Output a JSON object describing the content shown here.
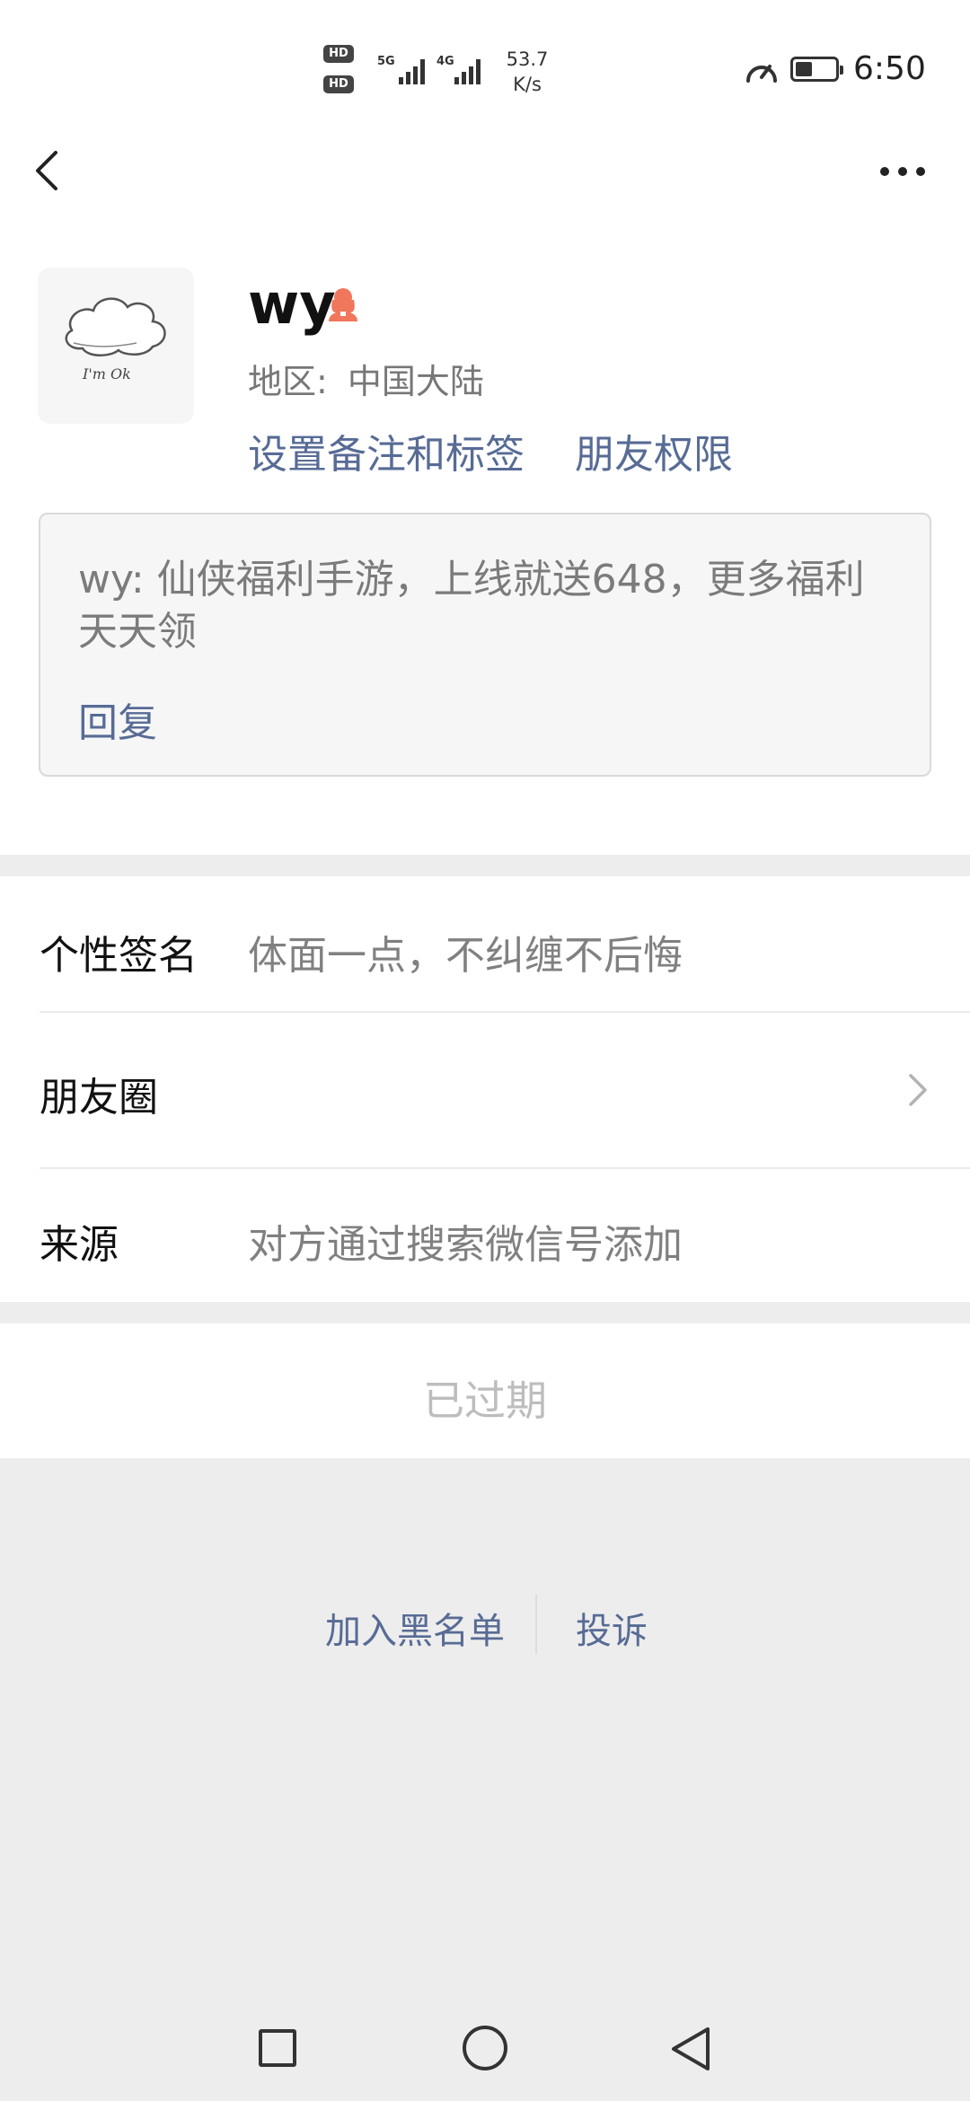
{
  "status_bar": {
    "hd1": "HD",
    "hd2": "HD",
    "net_type_1": "5G",
    "net_type_2": "4G",
    "net_speed_value": "53.7",
    "net_speed_unit": "K/s",
    "battery_level": 0.4,
    "time": "6:50"
  },
  "profile": {
    "name": "wy",
    "gender_icon": "female-user-icon",
    "region_label": "地区:",
    "region_value": "中国大陆",
    "remark_link": "设置备注和标签",
    "permission_link": "朋友权限"
  },
  "greeting": {
    "message": "wy: 仙侠福利手游，上线就送648，更多福利天天领",
    "reply_label": "回复"
  },
  "info": {
    "signature_label": "个性签名",
    "signature_value": "体面一点，不纠缠不后悔",
    "moments_label": "朋友圈",
    "source_label": "来源",
    "source_value": "对方通过搜索微信号添加"
  },
  "expired_label": "已过期",
  "footer": {
    "blacklist_label": "加入黑名单",
    "complain_label": "投诉"
  },
  "colors": {
    "link": "#576b95",
    "background": "#ededed",
    "gender_icon": "#f0765c"
  }
}
